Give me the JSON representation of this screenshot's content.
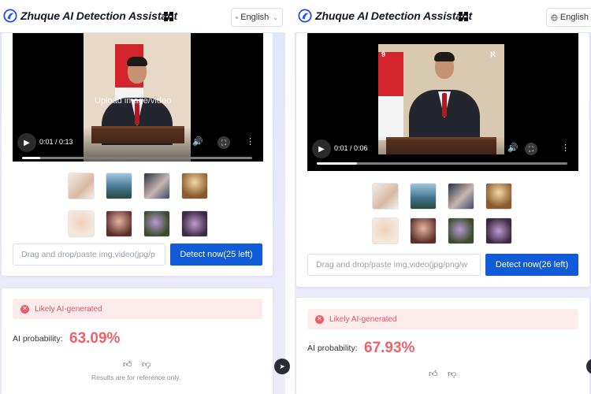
{
  "app_title": "Zhuque AI Detection Assistant",
  "left": {
    "language": "English",
    "video": {
      "overlay_text": "Upload image/video",
      "time": "0:01 / 0:13",
      "progress_fraction": 0.08
    },
    "input_placeholder": "Drag and drop/paste img,video(jpg/p",
    "detect_label": "Detect now(25 left)",
    "result": {
      "banner": "Likely AI-generated",
      "prob_label": "AI probability:",
      "prob_value": "63.09%",
      "note": "Results are for reference only."
    }
  },
  "right": {
    "language": "English",
    "video": {
      "time": "0:01 / 0:06",
      "progress_fraction": 0.16,
      "corner_left": "9",
      "corner_right": "ℵ"
    },
    "input_placeholder": "Drag and drop/paste img,video(jpg/png/w",
    "detect_label": "Detect now(26 left)",
    "result": {
      "banner": "Likely AI-generated",
      "prob_label": "AI probability:",
      "prob_value": "67.93%"
    }
  },
  "icons": {
    "logo": "zhuque-logo-icon",
    "grid": "apps-grid-icon",
    "globe": "globe-icon",
    "play": "play-icon",
    "volume": "volume-icon",
    "fullscreen": "fullscreen-icon",
    "more": "more-vertical-icon",
    "error": "error-circle-icon",
    "like": "thumbs-up-icon",
    "dislike": "thumbs-down-icon",
    "send": "send-icon"
  },
  "colors": {
    "brand_blue": "#0f5bd8",
    "danger": "#ef6068",
    "banner_bg": "#fdecec"
  }
}
